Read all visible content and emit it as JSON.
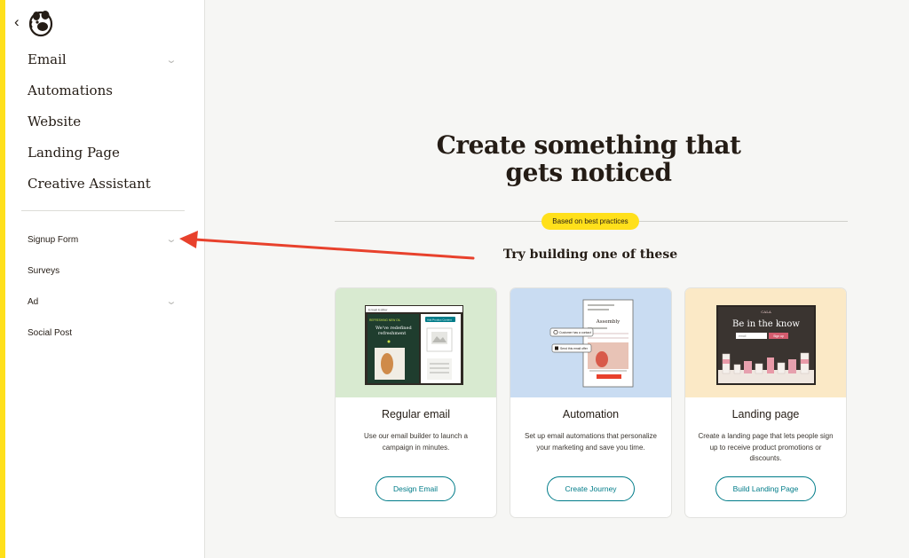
{
  "sidebar": {
    "primary_items": [
      {
        "label": "Email",
        "has_chevron": true
      },
      {
        "label": "Automations",
        "has_chevron": false
      },
      {
        "label": "Website",
        "has_chevron": false
      },
      {
        "label": "Landing Page",
        "has_chevron": false
      },
      {
        "label": "Creative Assistant",
        "has_chevron": false
      }
    ],
    "secondary_items": [
      {
        "label": "Signup Form",
        "has_chevron": true
      },
      {
        "label": "Surveys",
        "has_chevron": false
      },
      {
        "label": "Ad",
        "has_chevron": true
      },
      {
        "label": "Social Post",
        "has_chevron": false
      }
    ]
  },
  "main": {
    "hero_title_line1": "Create something that",
    "hero_title_line2": "gets noticed",
    "badge": "Based on best practices",
    "subtitle": "Try building one of these",
    "cards": [
      {
        "title": "Regular email",
        "description": "Use our email builder to launch a campaign in minutes.",
        "button": "Design Email",
        "visual_bg": "#d8ead0",
        "visual": {
          "top_label": "Email Editor",
          "headline": "We’ve redefined refreshment",
          "tag": "REFRESHING NEW OIL",
          "cta": "Add Product Content"
        }
      },
      {
        "title": "Automation",
        "description": "Set up email automations that personalize your marketing and save you time.",
        "button": "Create Journey",
        "visual_bg": "#c9dcf2",
        "visual": {
          "heading": "Assembly",
          "step1": "Customer has a contact",
          "step2": "Send this email offer"
        }
      },
      {
        "title": "Landing page",
        "description": "Create a landing page that lets people sign up to receive product promotions or discounts.",
        "button": "Build Landing Page",
        "visual_bg": "#fbe9c6",
        "visual": {
          "brand": "CALA",
          "headline": "Be in the know",
          "input_placeholder": "email",
          "submit": "Sign up"
        }
      }
    ]
  },
  "colors": {
    "accent_yellow": "#ffe01b",
    "teal": "#007c89",
    "annotation_arrow": "#e8412c"
  }
}
